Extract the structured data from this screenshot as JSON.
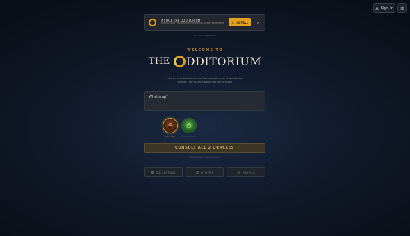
{
  "header": {
    "signin_label": "Sign In",
    "menu_icon": "hamburger-menu-icon"
  },
  "banner": {
    "title": "INSTALL THE ODDITORIUM",
    "subtitle": "Add it to your home screen for the full-screen experience.",
    "install_label": "INSTALL",
    "caption": "Not now, maybe later"
  },
  "hero": {
    "welcome": "WELCOME TO",
    "title_prefix": "THE",
    "title_rest": "DDITORIUM",
    "intro": "You've come to seek counsel from our wild array of oracles. Go on then - tell us, what would you like to know?"
  },
  "question": {
    "placeholder": "What's up?"
  },
  "oracles": [
    {
      "name": "Elisabetta",
      "active": true,
      "icon": "bearded-face-icon"
    },
    {
      "name": "Verdigrievous",
      "active": false,
      "icon": "green-mask-icon"
    },
    {
      "name": "",
      "active": false,
      "icon": "empty-slot-icon"
    },
    {
      "name": "",
      "active": false,
      "icon": "empty-slot-icon"
    },
    {
      "name": "",
      "active": false,
      "icon": "empty-slot-icon"
    }
  ],
  "consult": {
    "label": "CONSULT ALL 2 ORACLES",
    "hint": "Toggle a few oracles to begin"
  },
  "nav": [
    {
      "label": "COLLECTION",
      "icon": "grid-icon"
    },
    {
      "label": "OTHERS",
      "icon": "users-icon"
    },
    {
      "label": "PROFILE",
      "icon": "person-icon"
    }
  ],
  "colors": {
    "accent": "#e3a11e",
    "gold": "#c4862a",
    "background": "#111a2b"
  }
}
